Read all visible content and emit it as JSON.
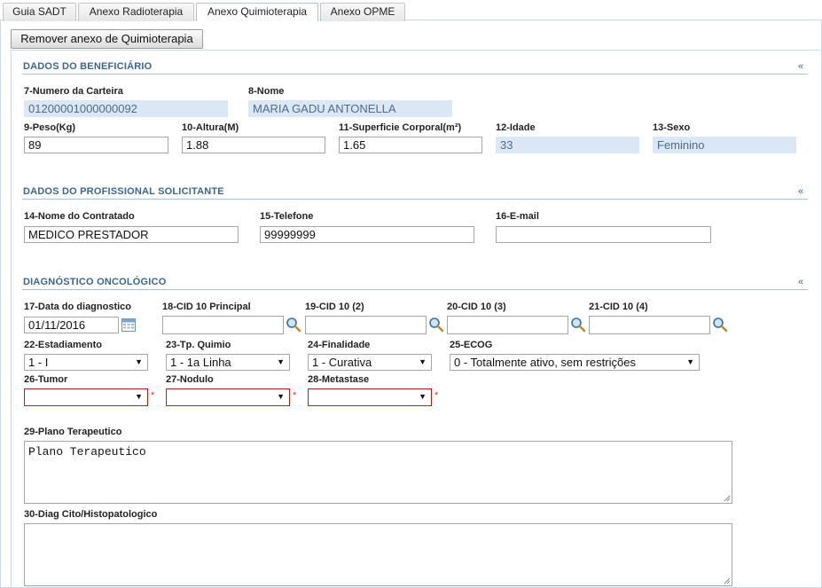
{
  "tabs": [
    {
      "label": "Guia SADT",
      "active": false
    },
    {
      "label": "Anexo Radioterapia",
      "active": false
    },
    {
      "label": "Anexo Quimioterapia",
      "active": true
    },
    {
      "label": "Anexo OPME",
      "active": false
    }
  ],
  "remove_button": "Remover anexo de Quimioterapia",
  "collapse_icon": "«",
  "beneficiario": {
    "title": "DADOS DO BENEFICIÁRIO",
    "carteira_label": "7-Numero da Carteira",
    "carteira_value": "01200001000000092",
    "nome_label": "8-Nome",
    "nome_value": "MARIA GADU ANTONELLA",
    "peso_label": "9-Peso(Kg)",
    "peso_value": "89",
    "altura_label": "10-Altura(M)",
    "altura_value": "1.88",
    "superficie_label": "11-Superficie Corporal(m²)",
    "superficie_value": "1.65",
    "idade_label": "12-Idade",
    "idade_value": "33",
    "sexo_label": "13-Sexo",
    "sexo_value": "Feminino"
  },
  "profissional": {
    "title": "DADOS DO PROFISSIONAL SOLICITANTE",
    "contratado_label": "14-Nome do Contratado",
    "contratado_value": "MEDICO PRESTADOR",
    "telefone_label": "15-Telefone",
    "telefone_value": "99999999",
    "email_label": "16-E-mail",
    "email_value": ""
  },
  "diagnostico": {
    "title": "DIAGNÓSTICO ONCOLÓGICO",
    "data_label": "17-Data do diagnostico",
    "data_value": "01/11/2016",
    "cid_principal_label": "18-CID 10 Principal",
    "cid2_label": "19-CID 10 (2)",
    "cid3_label": "20-CID 10 (3)",
    "cid4_label": "21-CID 10 (4)",
    "estadiamento_label": "22-Estadiamento",
    "estadiamento_value": "1 - I",
    "tp_quimio_label": "23-Tp. Quimio",
    "tp_quimio_value": "1 - 1a Linha",
    "finalidade_label": "24-Finalidade",
    "finalidade_value": "1 - Curativa",
    "ecog_label": "25-ECOG",
    "ecog_value": "0 - Totalmente ativo, sem restrições",
    "tumor_label": "26-Tumor",
    "nodulo_label": "27-Nodulo",
    "metastase_label": "28-Metastase",
    "required_mark": "*",
    "plano_label": "29-Plano Terapeutico",
    "plano_value": "Plano Terapeutico",
    "diag_cito_label": "30-Diag Cito/Histopatologico",
    "diag_cito_value": ""
  },
  "colors": {
    "section_title": "#3a6690",
    "readonly_bg": "#dbe7f5",
    "required_border": "#c01818"
  }
}
